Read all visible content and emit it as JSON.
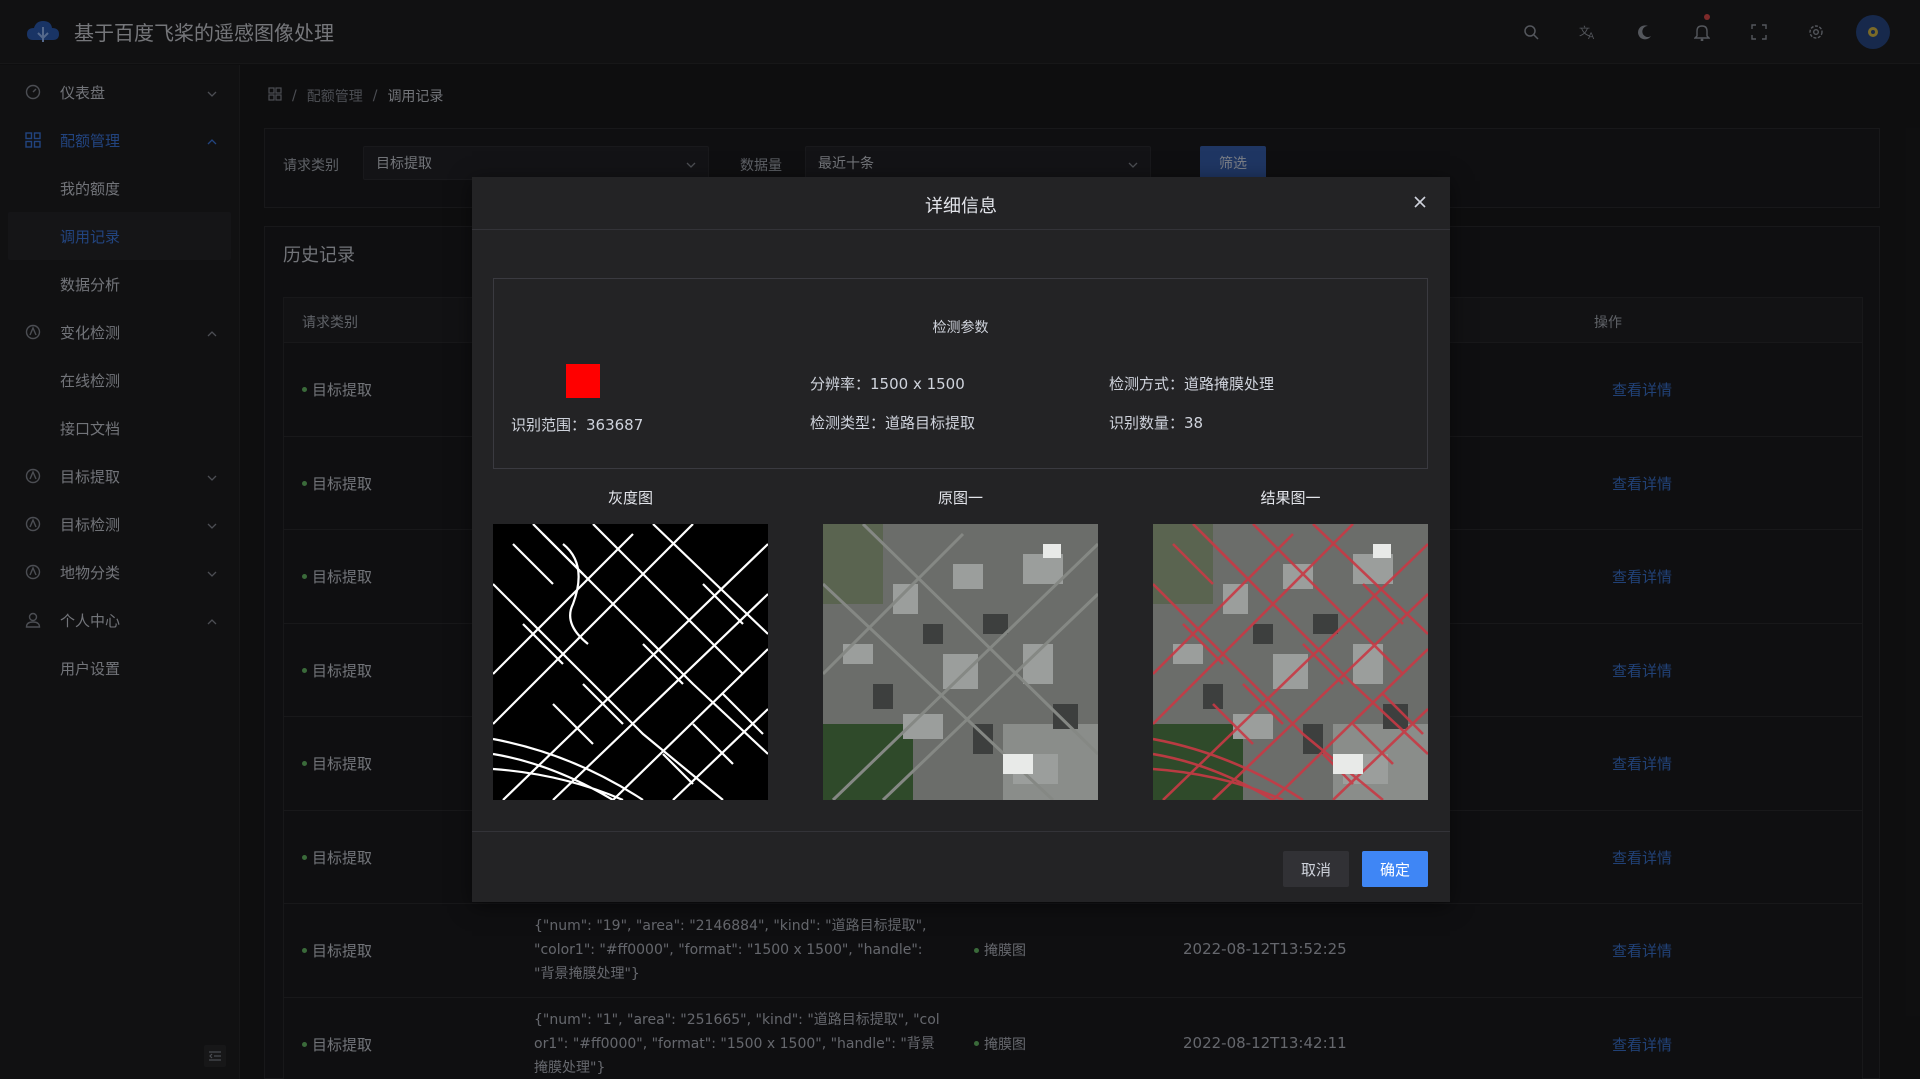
{
  "app": {
    "title": "基于百度飞桨的遥感图像处理"
  },
  "header": {
    "icons": [
      "search-icon",
      "translate-icon",
      "moon-icon",
      "bell-icon",
      "fullscreen-icon",
      "settings-icon"
    ],
    "avatar": "avatar"
  },
  "sidebar": {
    "items": [
      {
        "label": "仪表盘",
        "icon": "dashboard-icon"
      },
      {
        "label": "配额管理",
        "icon": "grid-icon",
        "active": true
      },
      {
        "label": "我的额度"
      },
      {
        "label": "调用记录",
        "active": true
      },
      {
        "label": "数据分析"
      },
      {
        "label": "变化检测",
        "icon": "change-icon"
      },
      {
        "label": "在线检测"
      },
      {
        "label": "接口文档"
      },
      {
        "label": "目标提取",
        "icon": "extract-icon"
      },
      {
        "label": "目标检测",
        "icon": "detect-icon"
      },
      {
        "label": "地物分类",
        "icon": "classify-icon"
      },
      {
        "label": "个人中心",
        "icon": "user-icon"
      },
      {
        "label": "用户设置"
      }
    ]
  },
  "breadcrumb": {
    "home_icon": "grid-icon",
    "level1": "配额管理",
    "level2": "调用记录",
    "sep": "/"
  },
  "filter": {
    "type_label": "请求类别",
    "type_value": "目标提取",
    "count_label": "数据量",
    "count_value": "最近十条",
    "button": "筛选"
  },
  "history": {
    "title": "历史记录",
    "columns": [
      "请求类别",
      "操作"
    ],
    "rows": [
      {
        "type": "目标提取",
        "params": "",
        "kind": "",
        "time": "",
        "op": "查看详情"
      },
      {
        "type": "目标提取",
        "params": "",
        "kind": "",
        "time": "",
        "op": "查看详情"
      },
      {
        "type": "目标提取",
        "params": "",
        "kind": "",
        "time": "",
        "op": "查看详情"
      },
      {
        "type": "目标提取",
        "params": "",
        "kind": "",
        "time": "",
        "op": "查看详情"
      },
      {
        "type": "目标提取",
        "params": "",
        "kind": "",
        "time": "",
        "op": "查看详情"
      },
      {
        "type": "目标提取",
        "params": "",
        "kind": "",
        "time": "",
        "op": "查看详情"
      },
      {
        "type": "目标提取",
        "params": "{\"num\": \"19\", \"area\": \"2146884\", \"kind\": \"道路目标提取\", \"color1\": \"#ff0000\", \"format\": \"1500 x 1500\", \"handle\": \"背景掩膜处理\"}",
        "kind": "掩膜图",
        "time": "2022-08-12T13:52:25",
        "op": "查看详情"
      },
      {
        "type": "目标提取",
        "params": "{\"num\": \"1\", \"area\": \"251665\", \"kind\": \"道路目标提取\", \"color1\": \"#ff0000\", \"format\": \"1500 x 1500\", \"handle\": \"背景掩膜处理\"}",
        "kind": "掩膜图",
        "time": "2022-08-12T13:42:11",
        "op": "查看详情"
      }
    ]
  },
  "dialog": {
    "title": "详细信息",
    "params_title": "检测参数",
    "color": "#ff0000",
    "range": "识别范围：363687",
    "resolution": "分辨率：1500 x 1500",
    "detect_type": "检测类型：道路目标提取",
    "detect_mode": "检测方式：道路掩膜处理",
    "count": "识别数量：38",
    "images": [
      "灰度图",
      "原图一",
      "结果图一"
    ],
    "cancel": "取消",
    "ok": "确定"
  },
  "colors": {
    "accent": "#3f86f5",
    "link": "#3d77d8",
    "status": "#6ac26a",
    "mask": "#ff0000"
  }
}
